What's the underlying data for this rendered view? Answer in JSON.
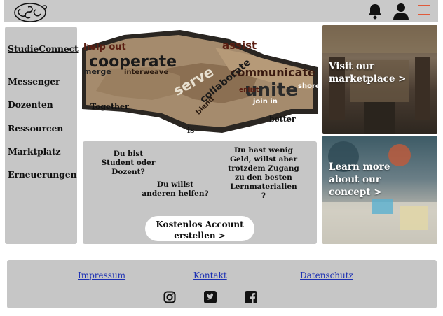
{
  "header": {
    "logo_icon": "logo-icon",
    "bell_icon": "bell-icon",
    "user_icon": "user-icon",
    "menu_icon": "hamburger-menu-icon"
  },
  "sidebar": {
    "brand": "StudieConnect",
    "items": [
      {
        "label": "Messenger"
      },
      {
        "label": "Dozenten"
      },
      {
        "label": "Ressourcen"
      },
      {
        "label": "Marktplatz"
      },
      {
        "label": "Erneuerungen"
      }
    ]
  },
  "hero": {
    "words": [
      "help out",
      "cooperate",
      "merge",
      "interweave",
      "assist",
      "communicate",
      "unite",
      "serve",
      "collaborate",
      "blend",
      "join in",
      "shore",
      "enlist",
      "Together",
      "is",
      "better"
    ]
  },
  "info": {
    "q1": "Du bist Student oder Dozent?",
    "q2": "Du willst anderen helfen?",
    "q3": "Du hast wenig Geld, willst aber trotzdem Zugang zu den besten Lernmaterialien ?",
    "cta_line1": "Kostenlos Account",
    "cta_line2": "erstellen >"
  },
  "cards": {
    "marketplace": {
      "line1": "Visit our",
      "line2": "marketplace >"
    },
    "concept": {
      "line1": "Learn more",
      "line2": "about our",
      "line3": "concept >"
    }
  },
  "footer": {
    "links": [
      "Impressum",
      "Kontakt",
      "Datenschutz"
    ],
    "social": [
      "instagram-icon",
      "twitter-icon",
      "facebook-icon"
    ]
  },
  "colors": {
    "header_bg": "#c9c9c9",
    "panel_bg": "#c6c6c6",
    "link": "#1b2fb3",
    "menu_accent": "#e05a3a"
  }
}
